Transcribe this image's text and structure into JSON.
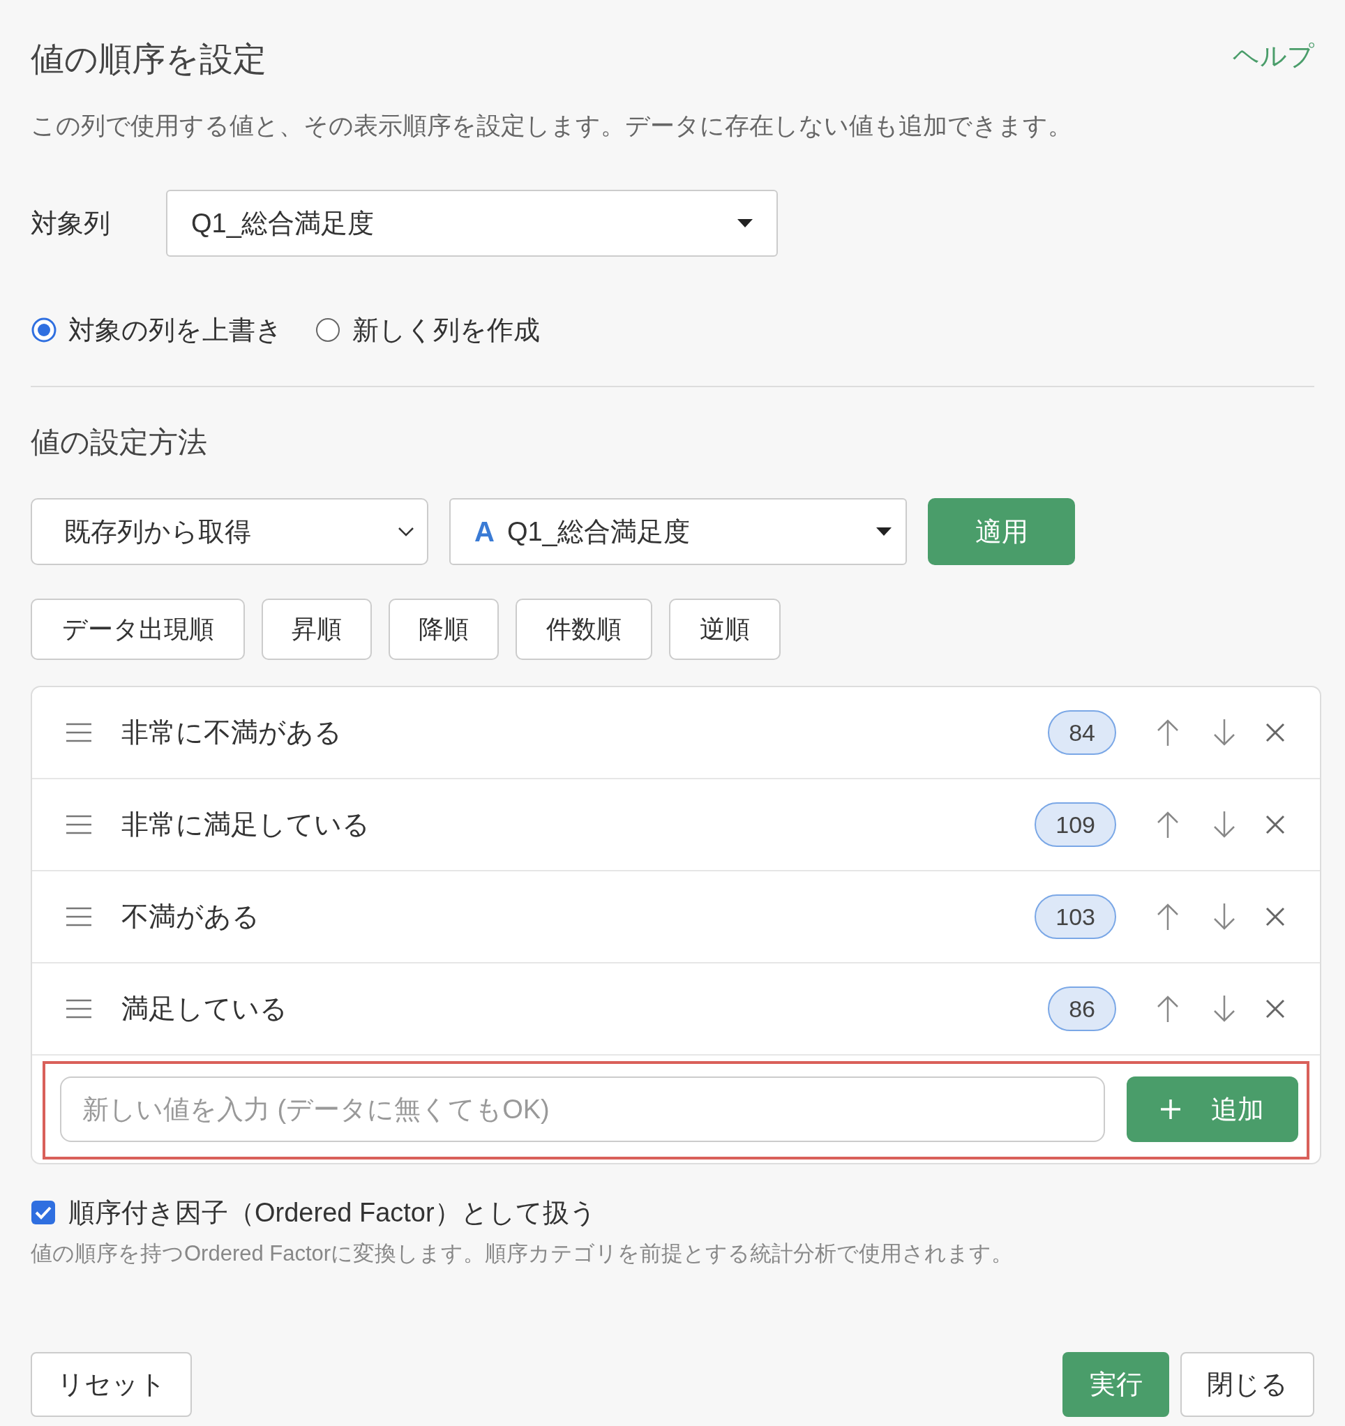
{
  "dialog": {
    "title": "値の順序を設定",
    "help_link": "ヘルプ",
    "description": "この列で使用する値と、その表示順序を設定します。データに存在しない値も追加できます。"
  },
  "target_column": {
    "label": "対象列",
    "value": "Q1_総合満足度"
  },
  "output_mode": [
    {
      "label": "対象の列を上書き",
      "selected": true
    },
    {
      "label": "新しく列を作成",
      "selected": false
    }
  ],
  "value_method": {
    "heading": "値の設定方法",
    "source": "既存列から取得",
    "type_mark": "A",
    "column": "Q1_総合満足度",
    "apply_button": "適用"
  },
  "sort_buttons": [
    "データ出現順",
    "昇順",
    "降順",
    "件数順",
    "逆順"
  ],
  "values": [
    {
      "label": "非常に不満がある",
      "count": "84"
    },
    {
      "label": "非常に満足している",
      "count": "109"
    },
    {
      "label": "不満がある",
      "count": "103"
    },
    {
      "label": "満足している",
      "count": "86"
    }
  ],
  "new_value": {
    "placeholder": "新しい値を入力 (データに無くてもOK)",
    "add_button": "追加"
  },
  "ordered_factor": {
    "label": "順序付き因子（Ordered Factor）として扱う",
    "checked": true,
    "note": "値の順序を持つOrdered Factorに変換します。順序カテゴリを前提とする統計分析で使用されます。"
  },
  "footer": {
    "reset": "リセット",
    "run": "実行",
    "close": "閉じる"
  }
}
